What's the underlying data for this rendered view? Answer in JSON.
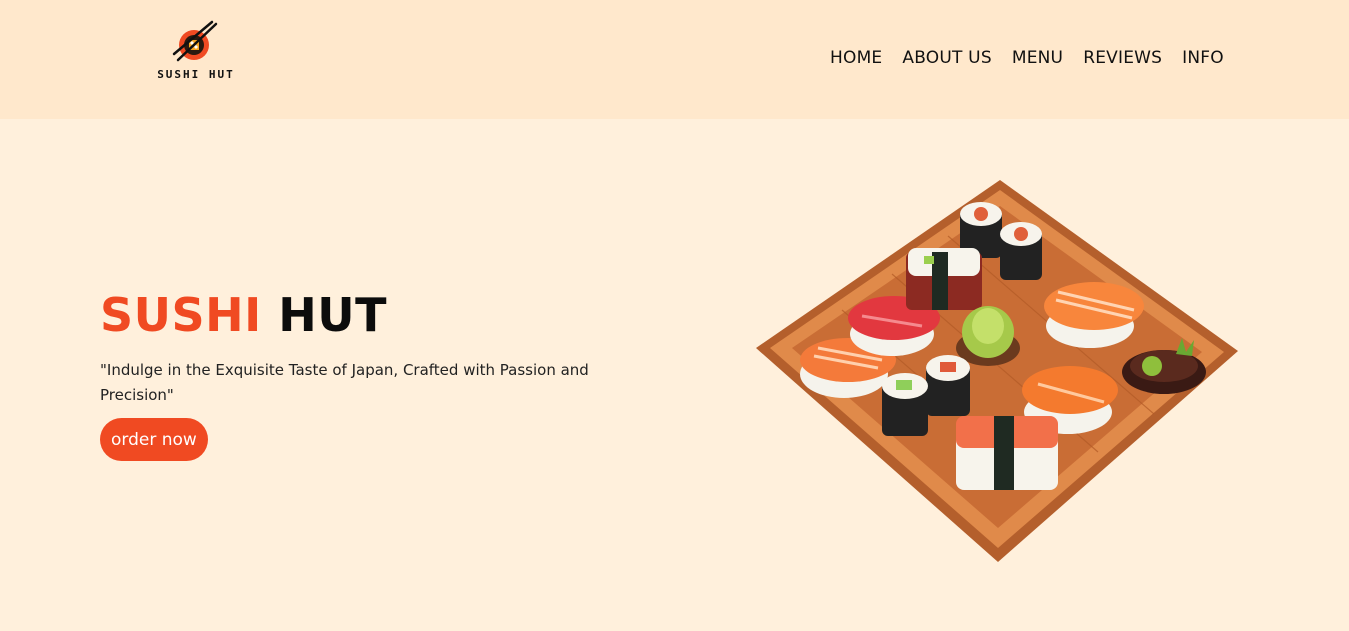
{
  "header": {
    "logo_text": "SUSHI HUT",
    "logo_icon": "sushi-chopsticks-logo-icon"
  },
  "nav": {
    "items": [
      {
        "label": "HOME"
      },
      {
        "label": "ABOUT US"
      },
      {
        "label": "MENU"
      },
      {
        "label": "REVIEWS"
      },
      {
        "label": "INFO"
      }
    ]
  },
  "hero": {
    "title_accent": "SUSHI",
    "title_rest": "HUT",
    "tagline": "\"Indulge in the Exquisite Taste of Japan, Crafted with Passion and Precision\"",
    "cta_label": "order now",
    "image_icon": "sushi-platter-image"
  },
  "colors": {
    "page_bg": "#fff0dc",
    "header_bg": "#ffe8cc",
    "accent": "#f04a22",
    "text": "#111111"
  }
}
